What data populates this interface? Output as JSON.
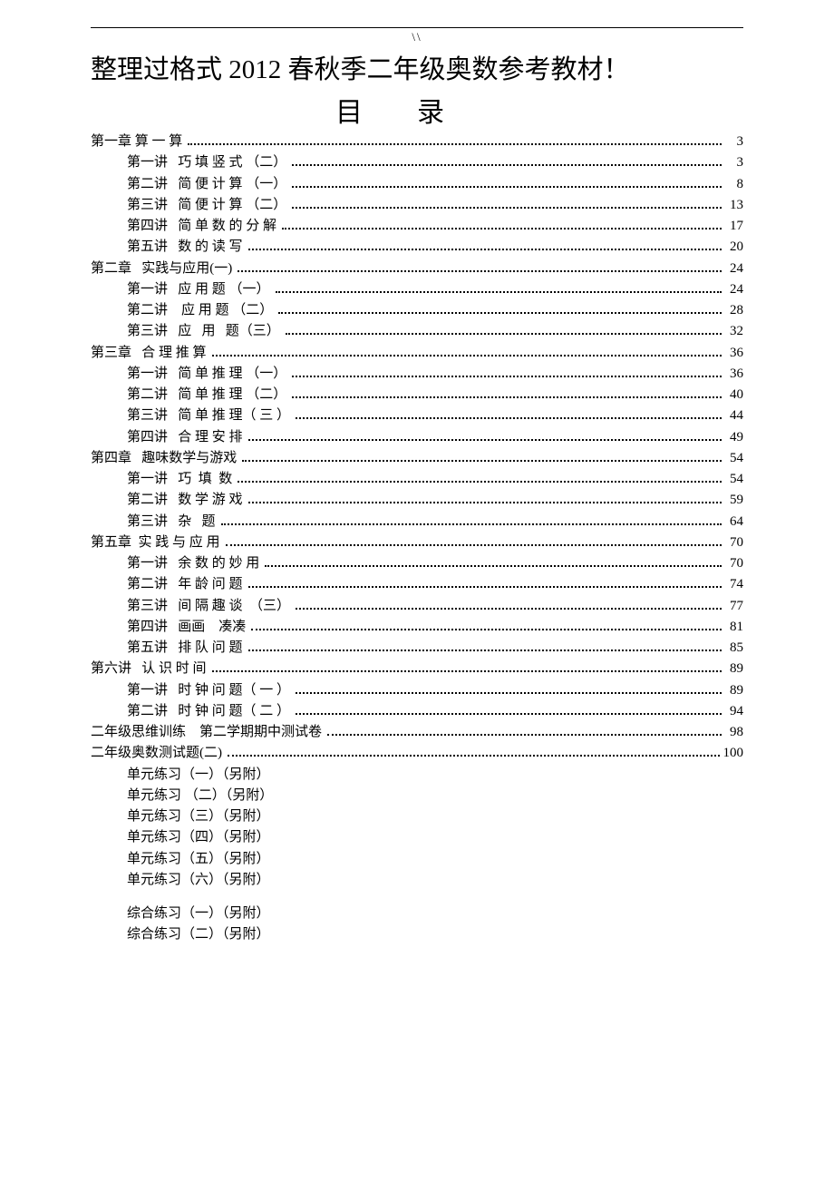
{
  "header_mark": "\\\\",
  "main_title": "整理过格式 2012 春秋季二年级奥数参考教材！",
  "mulu_title": "目录",
  "toc": [
    {
      "level": 0,
      "label": "第一章 算 一 算",
      "page": "3"
    },
    {
      "level": 1,
      "label": "第一讲   巧 填 竖 式 （二）",
      "page": "3"
    },
    {
      "level": 1,
      "label": "第二讲   简 便 计 算 （一）",
      "page": "8"
    },
    {
      "level": 1,
      "label": "第三讲   简 便 计 算 （二）",
      "page": "13"
    },
    {
      "level": 1,
      "label": "第四讲   简 单 数 的 分 解",
      "page": "17"
    },
    {
      "level": 1,
      "label": "第五讲   数 的 读 写",
      "page": "20"
    },
    {
      "level": 0,
      "label": "第二章   实践与应用(一)",
      "page": "24"
    },
    {
      "level": 1,
      "label": "第一讲   应 用 题 （一）",
      "page": "24"
    },
    {
      "level": 1,
      "label": "第二讲    应 用 题 （二）",
      "page": "28"
    },
    {
      "level": 1,
      "label": "第三讲   应   用   题（三）",
      "page": "32"
    },
    {
      "level": 0,
      "label": "第三章   合 理 推 算",
      "page": "36"
    },
    {
      "level": 1,
      "label": "第一讲   简 单 推 理 （一）",
      "page": "36"
    },
    {
      "level": 1,
      "label": "第二讲   简 单 推 理 （二）",
      "page": "40"
    },
    {
      "level": 1,
      "label": "第三讲   简 单 推 理（ 三 ）",
      "page": "44"
    },
    {
      "level": 1,
      "label": "第四讲   合 理 安 排",
      "page": "49"
    },
    {
      "level": 0,
      "label": "第四章   趣味数学与游戏",
      "page": "54"
    },
    {
      "level": 1,
      "label": "第一讲   巧  填  数",
      "page": "54"
    },
    {
      "level": 1,
      "label": "第二讲   数 学 游 戏",
      "page": "59"
    },
    {
      "level": 1,
      "label": "第三讲   杂   题",
      "page": "64"
    },
    {
      "level": 0,
      "label": "第五章  实 践 与 应 用",
      "page": "70"
    },
    {
      "level": 1,
      "label": "第一讲   余 数 的 妙 用",
      "page": "70"
    },
    {
      "level": 1,
      "label": "第二讲   年 龄 问 题",
      "page": "74"
    },
    {
      "level": 1,
      "label": "第三讲   间 隔 趣 谈  （三）",
      "page": "77"
    },
    {
      "level": 1,
      "label": "第四讲   画画    凑凑",
      "page": "81"
    },
    {
      "level": 1,
      "label": "第五讲   排 队 问 题",
      "page": "85"
    },
    {
      "level": 0,
      "label": "第六讲   认 识 时 间",
      "page": "89"
    },
    {
      "level": 1,
      "label": "第一讲   时 钟 问 题（ 一 ）",
      "page": "89"
    },
    {
      "level": 1,
      "label": "第二讲   时 钟 问 题（ 二 ）",
      "page": "94"
    },
    {
      "level": 0,
      "label": "二年级思维训练    第二学期期中测试卷",
      "page": "98"
    },
    {
      "level": 0,
      "label": "二年级奥数测试题(二)",
      "page": "100"
    }
  ],
  "appendix": [
    "单元练习（一）（另附）",
    "单元练习 （二）（另附）",
    "单元练习（三）（另附）",
    "单元练习（四）（另附）",
    "单元练习（五）（另附）",
    "单元练习（六）（另附）",
    "",
    "综合练习（一）（另附）",
    "综合练习（二）（另附）"
  ]
}
